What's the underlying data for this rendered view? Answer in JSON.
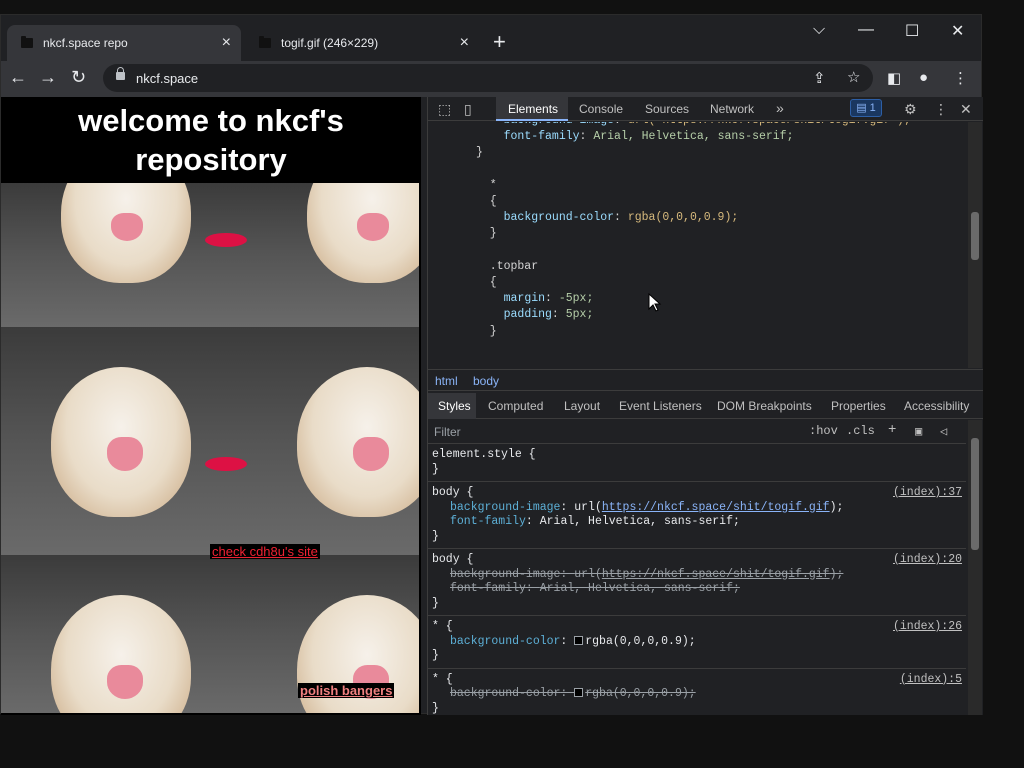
{
  "browser": {
    "tabs": [
      {
        "title": "nkcf.space repo",
        "active": true
      },
      {
        "title": "togif.gif (246×229)",
        "active": false
      }
    ],
    "url": "nkcf.space"
  },
  "page": {
    "title": "welcome to nkcf's repository",
    "link1": "check cdh8u's site",
    "link2": "polish bangers"
  },
  "devtools": {
    "tabs": [
      "Elements",
      "Console",
      "Sources",
      "Network"
    ],
    "more": "»",
    "issues_count": "1",
    "source_lines": [
      {
        "i": 0,
        "text": "    background-image: url(\"https://nkcf.space/shit/togif.gif\");"
      },
      {
        "i": 1,
        "text": "    font-family: Arial, Helvetica, sans-serif;"
      },
      {
        "i": 2,
        "text": "}"
      },
      {
        "i": 3,
        "text": ""
      },
      {
        "i": 4,
        "text": "  *"
      },
      {
        "i": 5,
        "text": "  {"
      },
      {
        "i": 6,
        "text": "    background-color: rgba(0,0,0,0.9);"
      },
      {
        "i": 7,
        "text": "  }"
      },
      {
        "i": 8,
        "text": ""
      },
      {
        "i": 9,
        "text": "  .topbar"
      },
      {
        "i": 10,
        "text": "  {"
      },
      {
        "i": 11,
        "text": "    margin: -5px;"
      },
      {
        "i": 12,
        "text": "    padding: 5px;"
      },
      {
        "i": 13,
        "text": "  }"
      }
    ],
    "breadcrumbs": [
      "html",
      "body"
    ],
    "panel_tabs": [
      "Styles",
      "Computed",
      "Layout",
      "Event Listeners",
      "DOM Breakpoints",
      "Properties",
      "Accessibility"
    ],
    "filter_placeholder": "Filter",
    "filter_buttons": [
      ":hov",
      ".cls",
      "+"
    ],
    "rules": [
      {
        "selector": "element.style {",
        "close": "}",
        "origin": ""
      },
      {
        "selector": "body {",
        "origin": "(index):37",
        "props": [
          {
            "name": "background-image",
            "value": "url(",
            "link": "https://nkcf.space/shit/togif.gif",
            "tail": ");",
            "struck": false
          },
          {
            "name": "font-family",
            "value": "Arial, Helvetica, sans-serif;",
            "struck": false
          }
        ],
        "close": "}"
      },
      {
        "selector": "body {",
        "origin": "(index):20",
        "props": [
          {
            "name": "background-image",
            "value": "url(",
            "link": "https://nkcf.space/shit/togif.gif",
            "tail": ");",
            "struck": true
          },
          {
            "name": "font-family",
            "value": "Arial, Helvetica, sans-serif;",
            "struck": true
          }
        ],
        "close": "}"
      },
      {
        "selector": "* {",
        "origin": "(index):26",
        "props": [
          {
            "name": "background-color",
            "value": "rgba(0,0,0,0.9);",
            "struck": false
          }
        ],
        "close": "}"
      },
      {
        "selector": "* {",
        "origin": "(index):5",
        "props": [
          {
            "name": "background-color",
            "value": "rgba(0,0,0,0.9);",
            "struck": true
          }
        ],
        "close": "}"
      }
    ]
  }
}
